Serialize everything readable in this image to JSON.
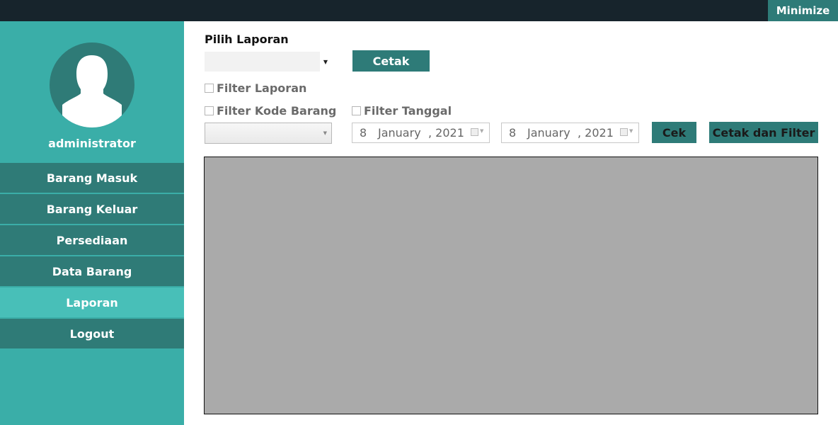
{
  "topbar": {
    "minimize_label": "Minimize"
  },
  "sidebar": {
    "username": "administrator",
    "items": [
      {
        "label": "Barang Masuk",
        "active": false
      },
      {
        "label": "Barang Keluar",
        "active": false
      },
      {
        "label": "Persediaan",
        "active": false
      },
      {
        "label": "Data Barang",
        "active": false
      },
      {
        "label": "Laporan",
        "active": true
      },
      {
        "label": "Logout",
        "active": false
      }
    ]
  },
  "main": {
    "pilih_laporan_label": "Pilih Laporan",
    "pilih_laporan_value": "",
    "cetak_label": "Cetak",
    "filter_laporan_label": "Filter Laporan",
    "filter_kode_label": "Filter Kode Barang",
    "filter_tanggal_label": "Filter Tanggal",
    "kode_barang_value": "",
    "date_from": {
      "day": "8",
      "month": "January",
      "year": ", 2021"
    },
    "date_to": {
      "day": "8",
      "month": "January",
      "year": ", 2021"
    },
    "cek_label": "Cek",
    "cetak_filter_label": "Cetak dan Filter"
  },
  "colors": {
    "topbar": "#17242c",
    "sidebar": "#3aaea8",
    "nav_item": "#2f7b77",
    "nav_active": "#48bfb8",
    "button": "#2e7b78",
    "report_area": "#aaaaaa"
  }
}
